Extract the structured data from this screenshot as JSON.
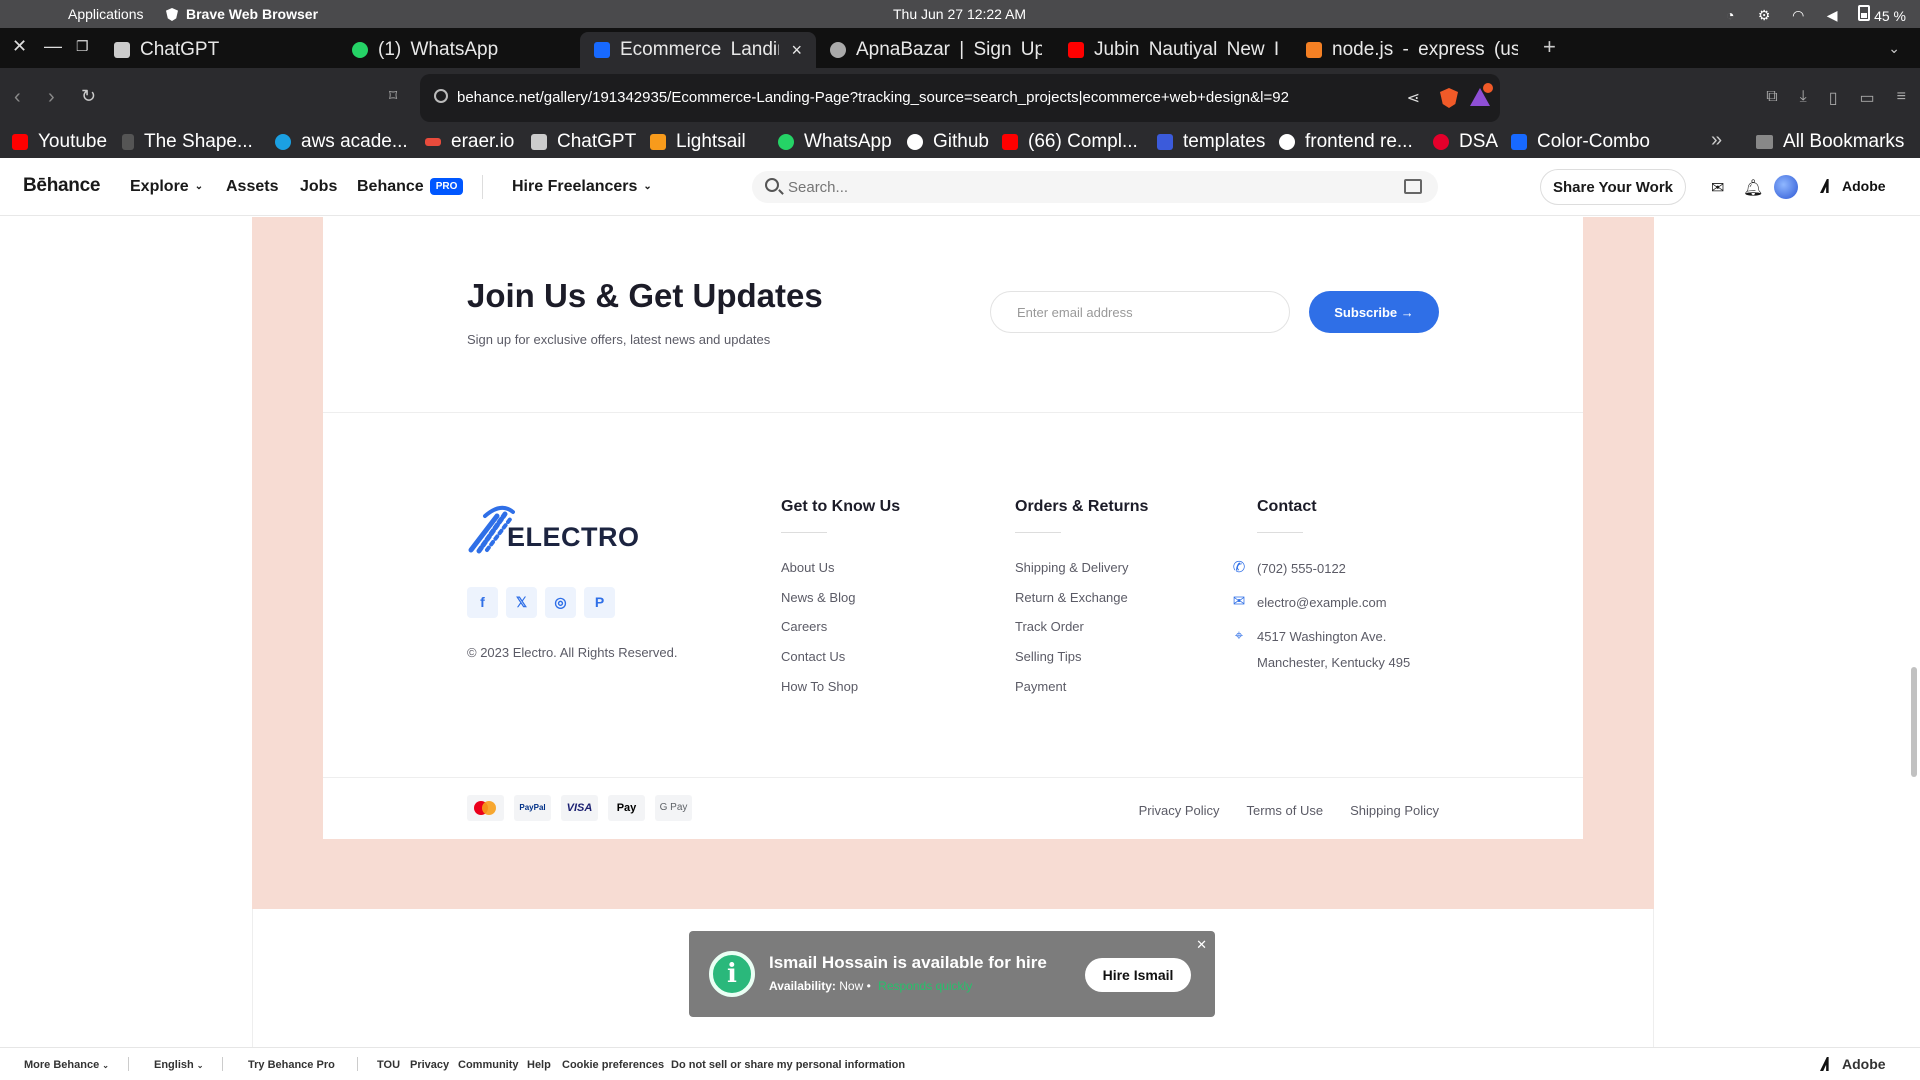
{
  "menubar": {
    "apps_label": "Applications",
    "browser_name": "Brave Web Browser",
    "clock": "Thu  Jun  27  12:22  AM",
    "battery": "45 %"
  },
  "tabs": [
    {
      "label": "ChatGPT",
      "color": "#cccccc"
    },
    {
      "label": "(1)  WhatsApp",
      "color": "#25d366"
    },
    {
      "label": "Ecommerce  Landin",
      "color": "#1769ff",
      "active": true
    },
    {
      "label": "ApnaBazar  |  Sign  Up",
      "color": "#aaaaaa"
    },
    {
      "label": "Jubin  Nautiyal  New  Ir",
      "color": "#ff0000"
    },
    {
      "label": "node.js  -  express  (usi",
      "color": "#f48024"
    }
  ],
  "address": {
    "url": "behance.net/gallery/191342935/Ecommerce-Landing-Page?tracking_source=search_projects|ecommerce+web+design&l=92"
  },
  "bookmarks": [
    {
      "label": "Youtube",
      "color": "#ff0000"
    },
    {
      "label": "The  Shape...",
      "color": "#666666"
    },
    {
      "label": "aws  acade...",
      "color": "#1ba0e2"
    },
    {
      "label": "eraer.io",
      "color": "#e84b3c"
    },
    {
      "label": "ChatGPT",
      "color": "#cccccc"
    },
    {
      "label": "Lightsail",
      "color": "#f89b1c"
    },
    {
      "label": "WhatsApp",
      "color": "#25d366"
    },
    {
      "label": "Github",
      "color": "#ffffff"
    },
    {
      "label": "(66)  Compl...",
      "color": "#ff0000"
    },
    {
      "label": "templates",
      "color": "#3b5bdb"
    },
    {
      "label": "frontend  re...",
      "color": "#ffffff"
    },
    {
      "label": "DSA",
      "color": "#e4002b"
    },
    {
      "label": "Color-Combo",
      "color": "#1769ff"
    }
  ],
  "bookmarks_all": "All  Bookmarks",
  "behance_nav": {
    "logo": "Bēhance",
    "explore": "Explore",
    "assets": "Assets",
    "jobs": "Jobs",
    "behance": "Behance",
    "pro_badge": "PRO",
    "hire_freelancers": "Hire Freelancers",
    "search_placeholder": "Search...",
    "share_your_work": "Share Your Work",
    "adobe": "Adobe"
  },
  "newsletter": {
    "title": "Join Us & Get Updates",
    "subtitle": "Sign up for exclusive offers, latest news and updates",
    "email_placeholder": "Enter email address",
    "subscribe": "Subscribe →"
  },
  "brand": {
    "name": "ELECTRO",
    "copyright": "© 2023 Electro. All Rights Reserved.",
    "socials": [
      "f",
      "𝕏",
      "◎",
      "P"
    ]
  },
  "footer_columns": {
    "get_to_know": {
      "title": "Get to Know Us",
      "links": [
        "About Us",
        "News & Blog",
        "Careers",
        "Contact Us",
        "How To Shop"
      ]
    },
    "orders": {
      "title": "Orders & Returns",
      "links": [
        "Shipping & Delivery",
        "Return & Exchange",
        "Track Order",
        "Selling Tips",
        "Payment"
      ]
    },
    "contact": {
      "title": "Contact",
      "phone": "(702) 555-0122",
      "email": "electro@example.com",
      "address_line1": "4517 Washington Ave.",
      "address_line2": "Manchester, Kentucky 495"
    }
  },
  "payments": [
    "",
    "PayPal",
    "VISA",
    "Pay",
    "G Pay"
  ],
  "legal_links": [
    "Privacy Policy",
    "Terms of Use",
    "Shipping Policy"
  ],
  "hire_popup": {
    "title": "Ismail Hossain is available for hire",
    "availability_label": "Availability:",
    "availability_value": "Now",
    "responds": "Responds quickly",
    "button": "Hire Ismail"
  },
  "footer_bar": {
    "more_behance": "More Behance",
    "english": "English",
    "try_pro": "Try Behance Pro",
    "links": [
      "TOU",
      "Privacy",
      "Community",
      "Help",
      "Cookie preferences",
      "Do not sell or share my personal information"
    ],
    "adobe": "Adobe"
  }
}
